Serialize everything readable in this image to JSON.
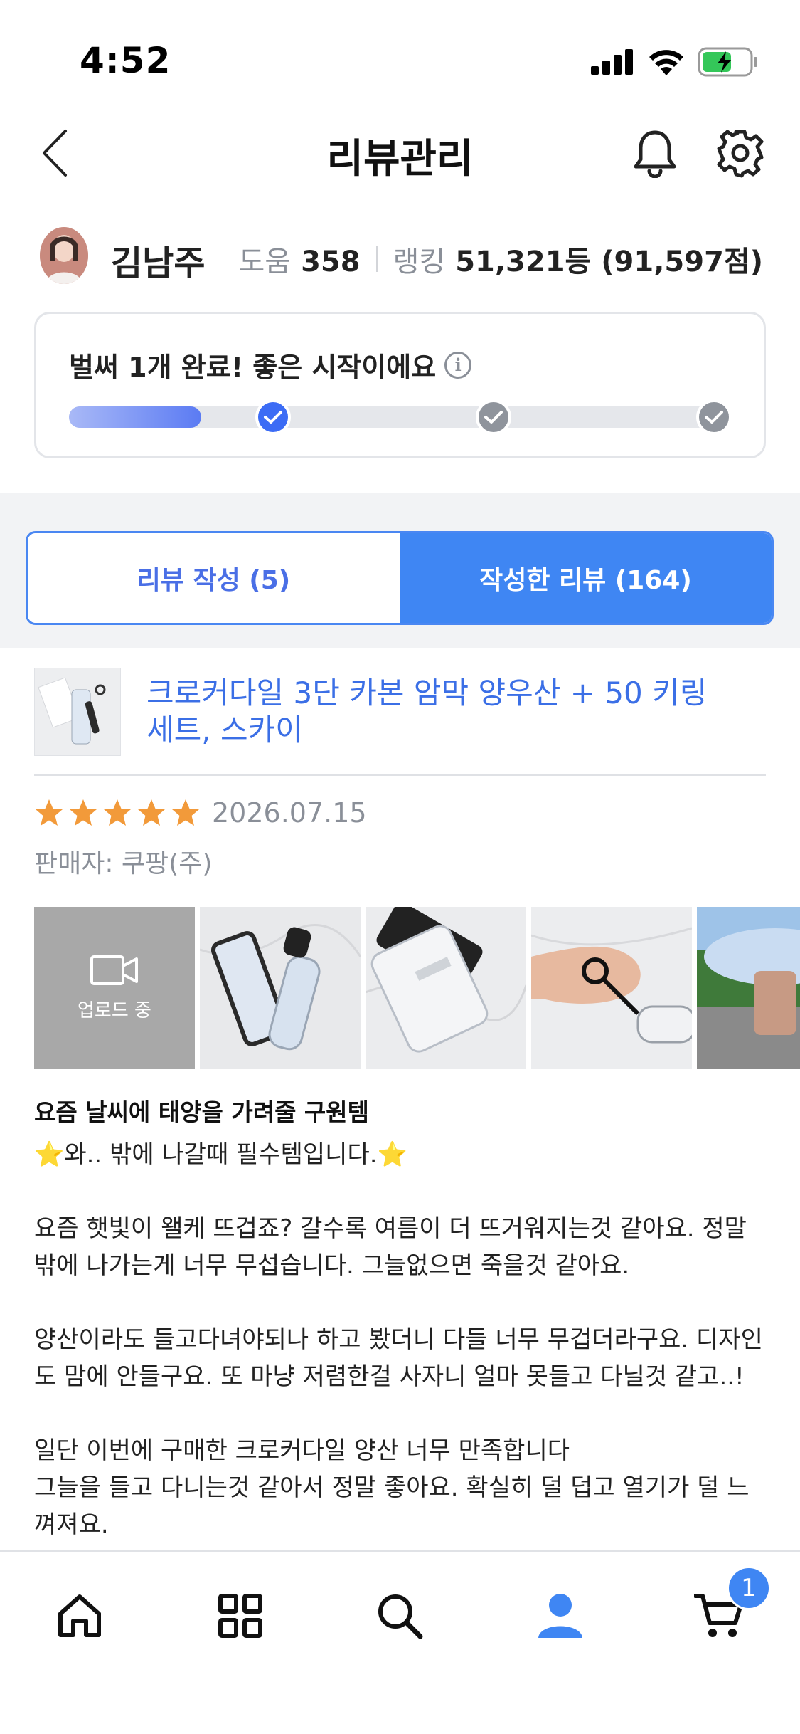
{
  "status_bar": {
    "time": "4:52"
  },
  "header": {
    "title": "리뷰관리"
  },
  "profile": {
    "name": "김남주",
    "help_label": "도움",
    "help_value": "358",
    "ranking_label": "랭킹",
    "ranking_value": "51,321등 (91,597점)"
  },
  "progress": {
    "message": "벌써 1개 완료! 좋은 시작이에요",
    "info_glyph": "i",
    "completed_steps": 1,
    "total_steps": 3,
    "fill_fraction": 0.2
  },
  "tabs": [
    {
      "label": "리뷰 작성 (5)",
      "active": false
    },
    {
      "label": "작성한 리뷰 (164)",
      "active": true
    }
  ],
  "product": {
    "name": "크로커다일 3단 카본 암막 양우산 + 50 키링 세트, 스카이"
  },
  "review": {
    "rating": 5,
    "date": "2026.07.15",
    "seller": "판매자: 쿠팡(주)",
    "uploading_label": "업로드 중",
    "title": "요즘 날씨에 태양을 가려줄 구원템",
    "paragraphs": [
      "⭐와.. 밖에 나갈때 필수템입니다.⭐",
      "요즘 햇빛이 왤케 뜨겁죠? 갈수록 여름이 더 뜨거워지는것 같아요. 정말 밖에 나가는게 너무 무섭습니다. 그늘없으면 죽을것 같아요.",
      "양산이라도 들고다녀야되나 하고 봤더니 다들 너무 무겁더라구요. 디자인도 맘에 안들구요. 또 마냥 저렴한걸 사자니 얼마 못들고 다닐것 같고..!",
      "일단 이번에 구매한 크로커다일 양산 너무 만족합니다\n그늘을 들고 다니는것 같아서 정말 좋아요. 확실히 덜 덥고 열기가 덜 느껴져요."
    ]
  },
  "bottom_nav": {
    "items": [
      "home-icon",
      "grid-icon",
      "search-icon",
      "profile-icon",
      "cart-icon"
    ],
    "cart_count": "1"
  },
  "colors": {
    "accent": "#3f86f3",
    "link": "#3b6fe6",
    "star": "#f29a3a"
  }
}
